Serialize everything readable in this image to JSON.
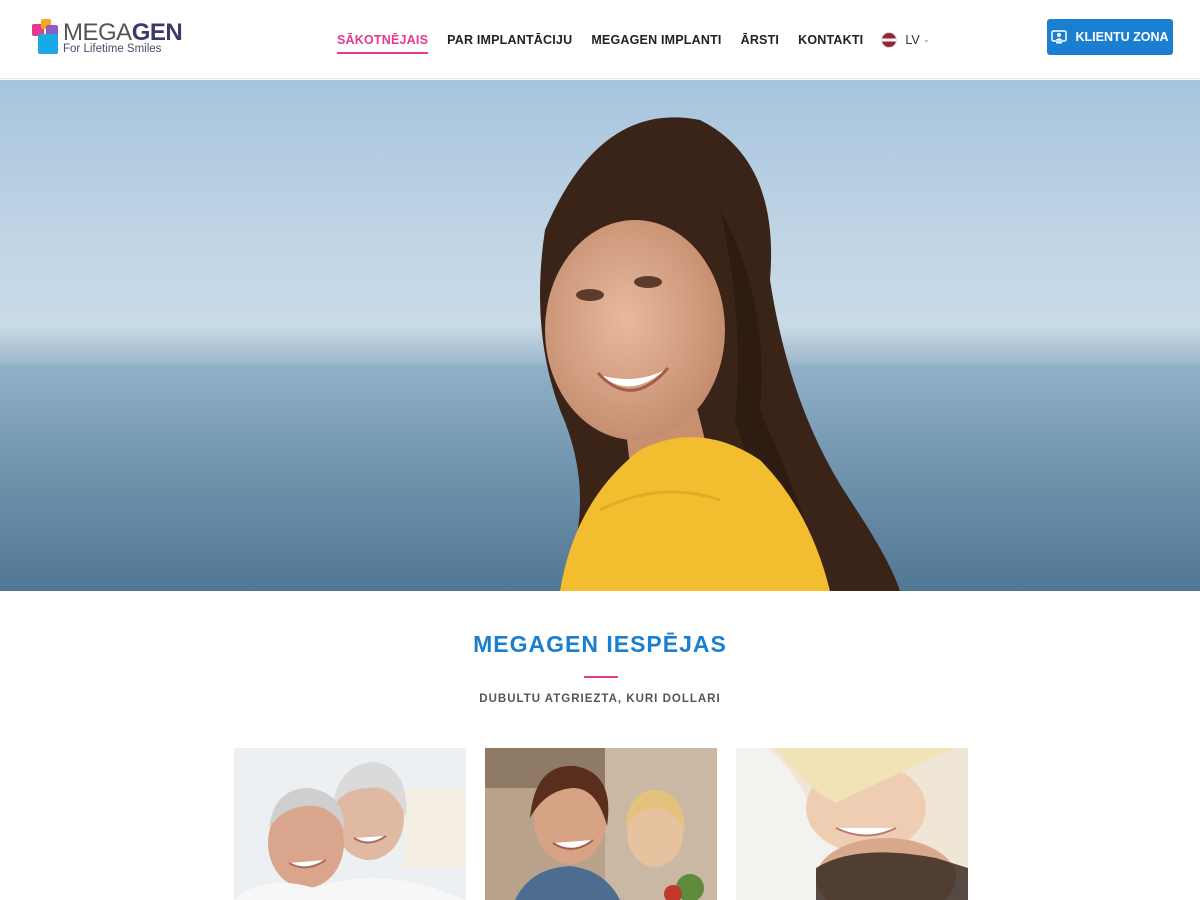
{
  "brand": {
    "name_part1": "MEGA",
    "name_part2": "GEN",
    "tagline": "For Lifetime Smiles"
  },
  "nav": {
    "items": [
      {
        "label": "SĀKOTNĒJAIS",
        "active": true
      },
      {
        "label": "PAR IMPLANTĀCIJU",
        "active": false
      },
      {
        "label": "MEGAGEN IMPLANTI",
        "active": false
      },
      {
        "label": "ĀRSTI",
        "active": false
      },
      {
        "label": "KONTAKTI",
        "active": false
      }
    ],
    "language": "LV"
  },
  "client_button": {
    "label": "KLIENTU ZONA"
  },
  "section": {
    "title": "MEGAGEN IESPĒJAS",
    "subtitle": "DUBULTU ATGRIEZTA, KURI DOLLARI"
  },
  "colors": {
    "accent_pink": "#e6398f",
    "primary_blue": "#1a7fd1"
  }
}
